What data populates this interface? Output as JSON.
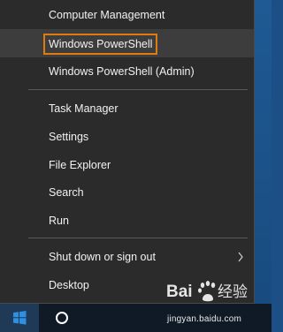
{
  "menu": {
    "items": [
      {
        "label": "Computer Management"
      },
      {
        "label": "Windows PowerShell"
      },
      {
        "label": "Windows PowerShell (Admin)"
      },
      {
        "label": "Task Manager"
      },
      {
        "label": "Settings"
      },
      {
        "label": "File Explorer"
      },
      {
        "label": "Search"
      },
      {
        "label": "Run"
      },
      {
        "label": "Shut down or sign out"
      },
      {
        "label": "Desktop"
      }
    ],
    "highlight_color": "#e07b12"
  },
  "taskbar": {
    "start_icon": "windows-logo-icon",
    "search_icon": "cortana-circle-icon"
  },
  "watermark": {
    "logo_text": "Baidu经验",
    "url": "jingyan.baidu.com"
  }
}
